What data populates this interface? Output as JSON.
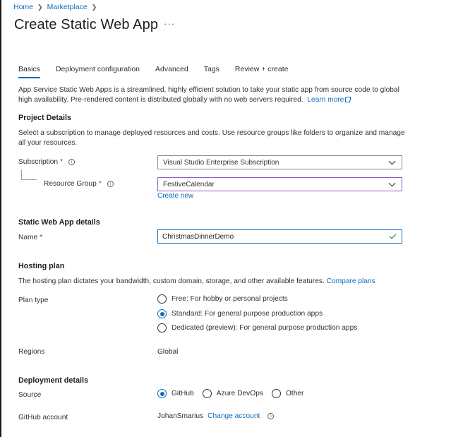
{
  "breadcrumb": {
    "items": [
      "Home",
      "Marketplace"
    ]
  },
  "page": {
    "title": "Create Static Web App",
    "more": "···"
  },
  "tabs": [
    {
      "label": "Basics",
      "active": true
    },
    {
      "label": "Deployment configuration",
      "active": false
    },
    {
      "label": "Advanced",
      "active": false
    },
    {
      "label": "Tags",
      "active": false
    },
    {
      "label": "Review + create",
      "active": false
    }
  ],
  "intro": {
    "text": "App Service Static Web Apps is a streamlined, highly efficient solution to take your static app from source code to global high availability. Pre-rendered content is distributed globally with no web servers required.",
    "learn_more": "Learn more"
  },
  "project": {
    "heading": "Project Details",
    "description": "Select a subscription to manage deployed resources and costs. Use resource groups like folders to organize and manage all your resources.",
    "subscription_label": "Subscription",
    "subscription_value": "Visual Studio Enterprise Subscription",
    "resource_group_label": "Resource Group",
    "resource_group_value": "FestiveCalendar",
    "create_new": "Create new",
    "required_mark": "*"
  },
  "details": {
    "heading": "Static Web App details",
    "name_label": "Name",
    "name_value": "ChristmasDinnerDemo"
  },
  "hosting": {
    "heading": "Hosting plan",
    "description": "The hosting plan dictates your bandwidth, custom domain, storage, and other available features.",
    "compare": "Compare plans",
    "plan_type_label": "Plan type",
    "plans": [
      {
        "label": "Free: For hobby or personal projects",
        "selected": false
      },
      {
        "label": "Standard: For general purpose production apps",
        "selected": true
      },
      {
        "label": "Dedicated (preview): For general purpose production apps",
        "selected": false
      }
    ],
    "regions_label": "Regions",
    "regions_value": "Global"
  },
  "deployment": {
    "heading": "Deployment details",
    "source_label": "Source",
    "sources": [
      {
        "label": "GitHub",
        "selected": true
      },
      {
        "label": "Azure DevOps",
        "selected": false
      },
      {
        "label": "Other",
        "selected": false
      }
    ],
    "account_label": "GitHub account",
    "account_value": "JohanSmarius",
    "change_account": "Change account"
  },
  "colors": {
    "accent": "#0f6cbd",
    "required": "#a4262c",
    "valid": "#107c10",
    "focus": "#8764b8"
  }
}
